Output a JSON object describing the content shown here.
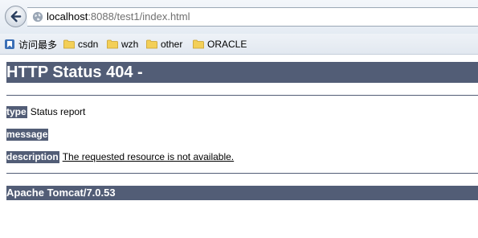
{
  "browser": {
    "url_host": "localhost",
    "url_rest": ":8088/test1/index.html",
    "bookmarks": [
      {
        "label": "访问最多",
        "icon": "bookmark-icon"
      },
      {
        "label": "csdn",
        "icon": "folder-icon"
      },
      {
        "label": "wzh",
        "icon": "folder-icon"
      },
      {
        "label": "other",
        "icon": "folder-icon"
      },
      {
        "label": "ORACLE",
        "icon": "folder-icon"
      }
    ]
  },
  "page": {
    "title": "HTTP Status 404 -",
    "type_label": "type",
    "type_value": "Status report",
    "message_label": "message",
    "message_value": "",
    "description_label": "description",
    "description_value": "The requested resource is not available.",
    "footer": "Apache Tomcat/7.0.53"
  },
  "colors": {
    "header_bg": "#525d76",
    "header_text": "#ffffff"
  }
}
